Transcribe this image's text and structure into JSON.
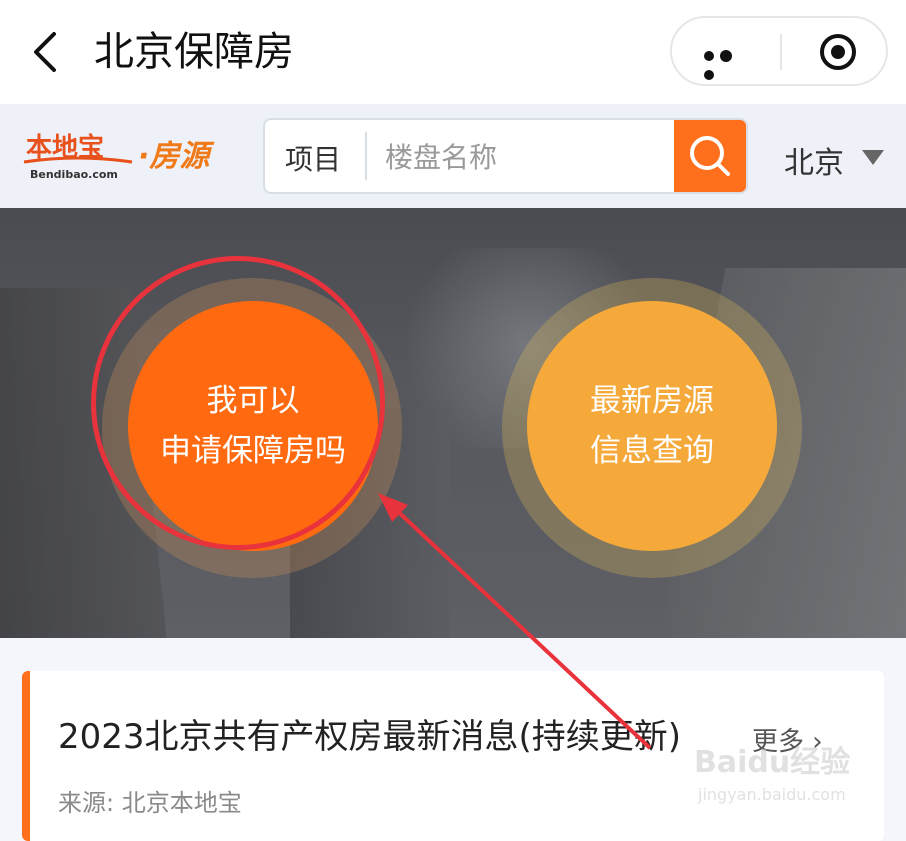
{
  "topbar": {
    "title": "北京保障房"
  },
  "header": {
    "logo_main": "本地宝",
    "logo_sub": "Bendibao.com",
    "logo_section": "·房源",
    "search_category": "项目",
    "search_placeholder": "楼盘名称",
    "city": "北京"
  },
  "banner": {
    "left_button_line1": "我可以",
    "left_button_line2": "申请保障房吗",
    "right_button_line1": "最新房源",
    "right_button_line2": "信息查询"
  },
  "news": {
    "title": "2023北京共有产权房最新消息(持续更新)",
    "more": "更多 ›",
    "source": "来源: 北京本地宝"
  },
  "watermark": {
    "brand": "Baidu经验",
    "url": "jingyan.baidu.com"
  },
  "colors": {
    "accent_orange": "#ff6f1c",
    "left_circle": "#ff6a10",
    "right_circle": "#f5a93a",
    "annotation_red": "#e8323c"
  }
}
